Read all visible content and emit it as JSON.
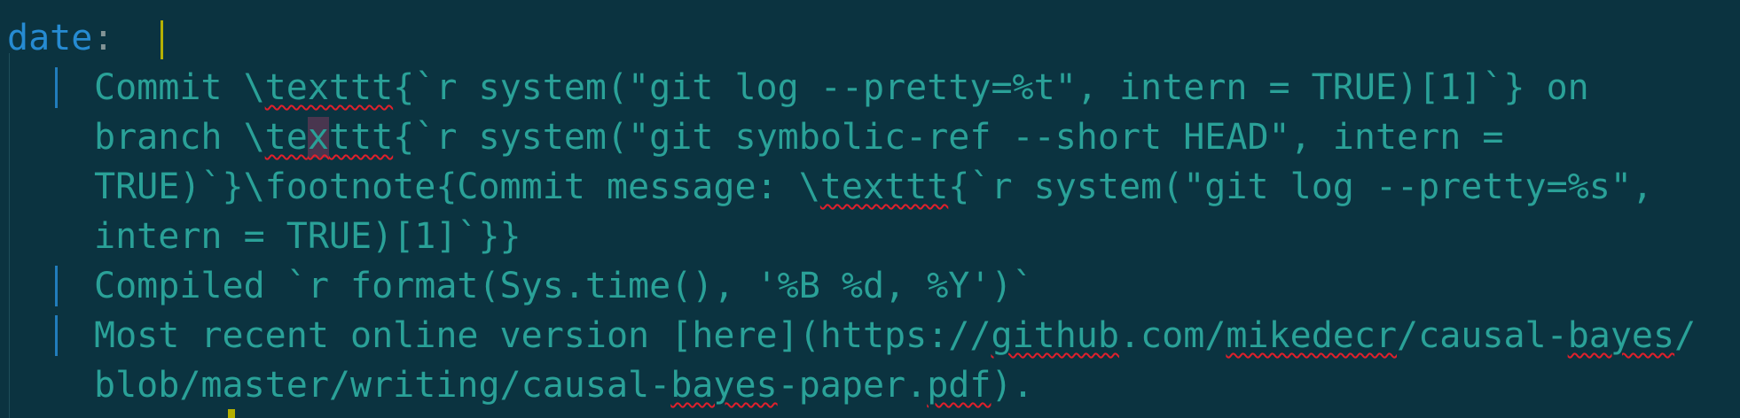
{
  "editor": {
    "key": "date",
    "colon": ":",
    "lines": {
      "l1a": "Commit \\",
      "l1b": "texttt",
      "l1c": "{`r system(\"git log --pretty=%t\", intern = TRUE)[1]`} on",
      "l2a": "branch \\",
      "l2b": "te",
      "l2c": "x",
      "l2d": "ttt",
      "l2e": "{`r system(\"git symbolic-ref --short HEAD\", intern =",
      "l3a": "TRUE)`}\\footnote{Commit message: \\",
      "l3b": "texttt",
      "l3c": "{`r system(\"git log --pretty=%s\",",
      "l4": "intern = TRUE)[1]`}}",
      "l5": "Compiled `r format(Sys.time(), '%B %d, %Y')`",
      "l6a": "Most recent online version [here](https://",
      "l6b": "github",
      "l6c": ".com/",
      "l6d": "mikedecr",
      "l6e": "/causal-",
      "l6f": "bayes",
      "l6g": "/",
      "l7a": "blob/master/writing/causal-",
      "l7b": "bayes",
      "l7c": "-paper.",
      "l7d": "pdf",
      "l7e": ")."
    },
    "colors": {
      "background": "#0b3340",
      "string": "#2aa198",
      "key": "#268bd2",
      "cursor": "#b5b000",
      "spell_error": "#e0202c"
    }
  }
}
